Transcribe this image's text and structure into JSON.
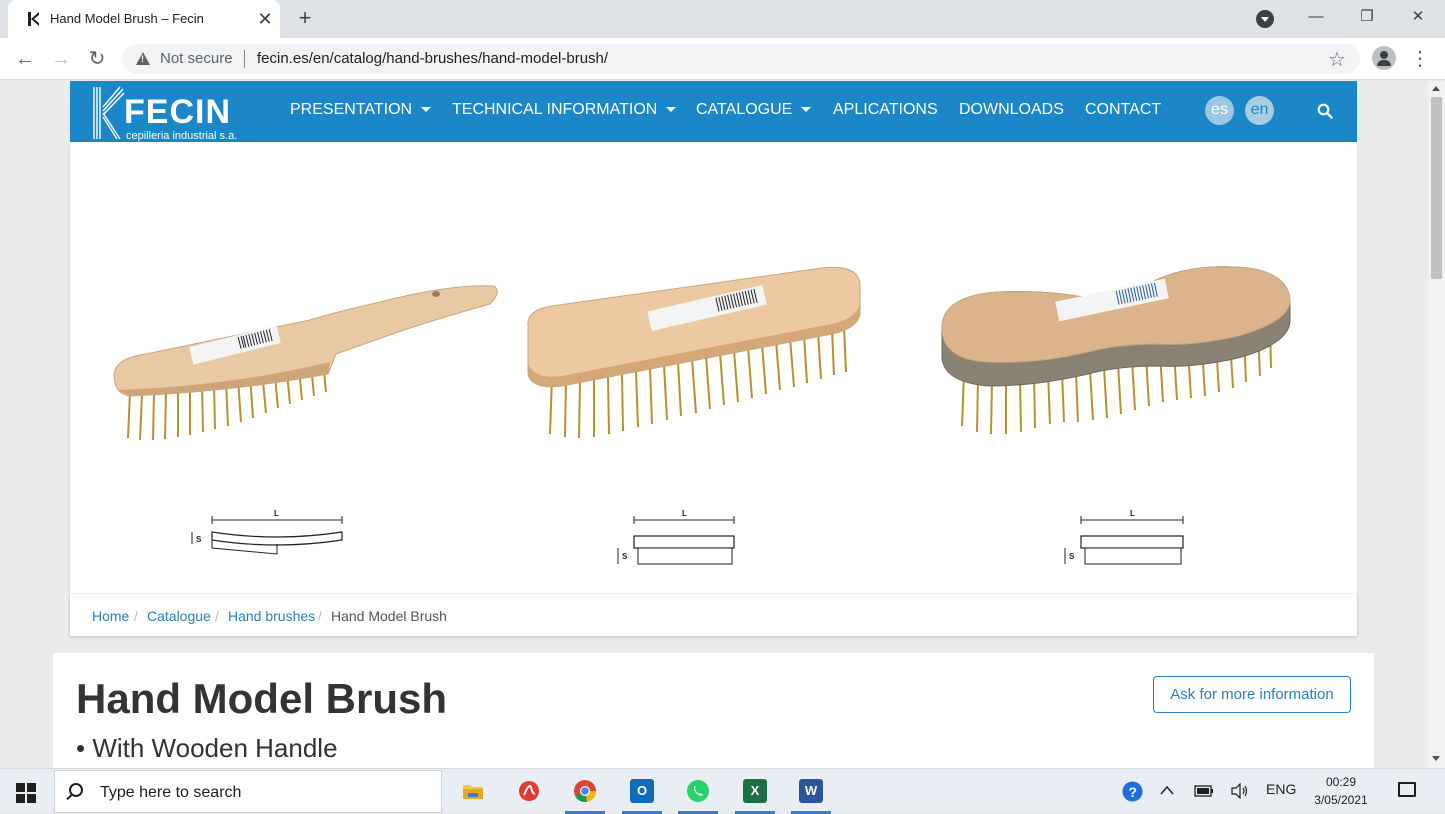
{
  "browser": {
    "tab_title": "Hand Model Brush – Fecin",
    "tab_close": "✕",
    "new_tab": "+",
    "security_label": "Not secure",
    "url": "fecin.es/en/catalog/hand-brushes/hand-model-brush/",
    "win_minimize": "—",
    "win_restore": "❐",
    "win_close": "✕",
    "back": "←",
    "forward": "→",
    "reload": "↻",
    "star": "☆",
    "menu": "⋮"
  },
  "site": {
    "brand": "FECIN",
    "brand_tagline": "cepilleria industrial s.a.",
    "brand_color": "#1b87c9",
    "nav": [
      {
        "label": "PRESENTATION",
        "dropdown": true
      },
      {
        "label": "TECHNICAL INFORMATION",
        "dropdown": true
      },
      {
        "label": "CATALOGUE",
        "dropdown": true
      },
      {
        "label": "APLICATIONS",
        "dropdown": false
      },
      {
        "label": "DOWNLOADS",
        "dropdown": false
      },
      {
        "label": "CONTACT",
        "dropdown": false
      }
    ],
    "languages": [
      {
        "code": "es",
        "active": false
      },
      {
        "code": "en",
        "active": true
      }
    ]
  },
  "hero": {
    "diagram_labels": {
      "length": "L",
      "section": "S"
    }
  },
  "breadcrumb": [
    {
      "label": "Home",
      "link": true
    },
    {
      "label": "Catalogue",
      "link": true
    },
    {
      "label": "Hand brushes",
      "link": true
    },
    {
      "label": "Hand Model Brush",
      "link": false
    }
  ],
  "breadcrumb_sep": "/",
  "product": {
    "title": "Hand Model Brush",
    "subtitle": "• With Wooden Handle",
    "ask_button": "Ask for more information"
  },
  "taskbar": {
    "search_placeholder": "Type here to search",
    "apps": [
      "file-explorer",
      "acrobat",
      "chrome",
      "outlook",
      "whatsapp",
      "excel",
      "word"
    ],
    "language": "ENG",
    "time": "00:29",
    "date": "3/05/2021"
  }
}
